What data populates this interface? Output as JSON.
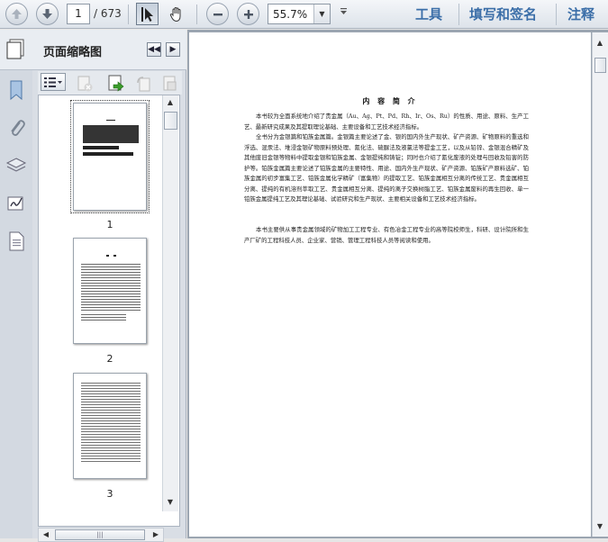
{
  "toolbar": {
    "page_current": "1",
    "page_total": "/ 673",
    "zoom": "55.7%",
    "tools_label": "工具",
    "fill_sign_label": "填写和签名",
    "comment_label": "注释"
  },
  "panel": {
    "title": "页面缩略图"
  },
  "thumbnails": [
    {
      "label": "1"
    },
    {
      "label": "2"
    },
    {
      "label": "3"
    }
  ],
  "document": {
    "title": "内 容 简 介",
    "paragraphs": [
      "本书较为全面系统地介绍了贵金属（Au、Ag、Pt、Pd、Rh、Ir、Os、Ru）的性质、用途、原料、生产工艺、最新研究成果及其提取理论基础、主要设备和工艺技术经济指标。",
      "全书分为金银篇和铂族金属篇。金银篇主要论述了金、银的国内外生产现状、矿产资源、矿物原料的重选和浮选、混汞法、堆浸金银矿物原料预处理、氰化法、硫脲法及液氯法等提金工艺，以及从铅锌、金银混合精矿及其他废旧金银等物料中提取金银和铂族金属、金银提纯和铸锭；同时也介绍了氰化废液的处理与回收及铅害的防护等。铂族金属篇主要论述了铂族金属的主要特性、用途、国内外生产现状、矿产资源、铂族矿产原料选矿、铂族金属的初步富集工艺、铂族金属化学精矿（富集物）的提取工艺、铂族金属相互分离的传统工艺、贵金属相互分离、提纯的有机溶剂萃取工艺、贵金属相互分离、提纯的离子交换树脂工艺、铂族金属废料的再生回收、单一铂族金属提纯工艺及其理论基础、试验研究和生产现状、主要相关设备和工艺技术经济指标。",
      "本书主要供从事贵金属领域的矿物加工工程专业、有色冶金工程专业的高等院校师生，科研、设计院所和生产厂矿的工程科技人员、企业家、营销、管理工程科技人员等阅读和使用。"
    ]
  }
}
